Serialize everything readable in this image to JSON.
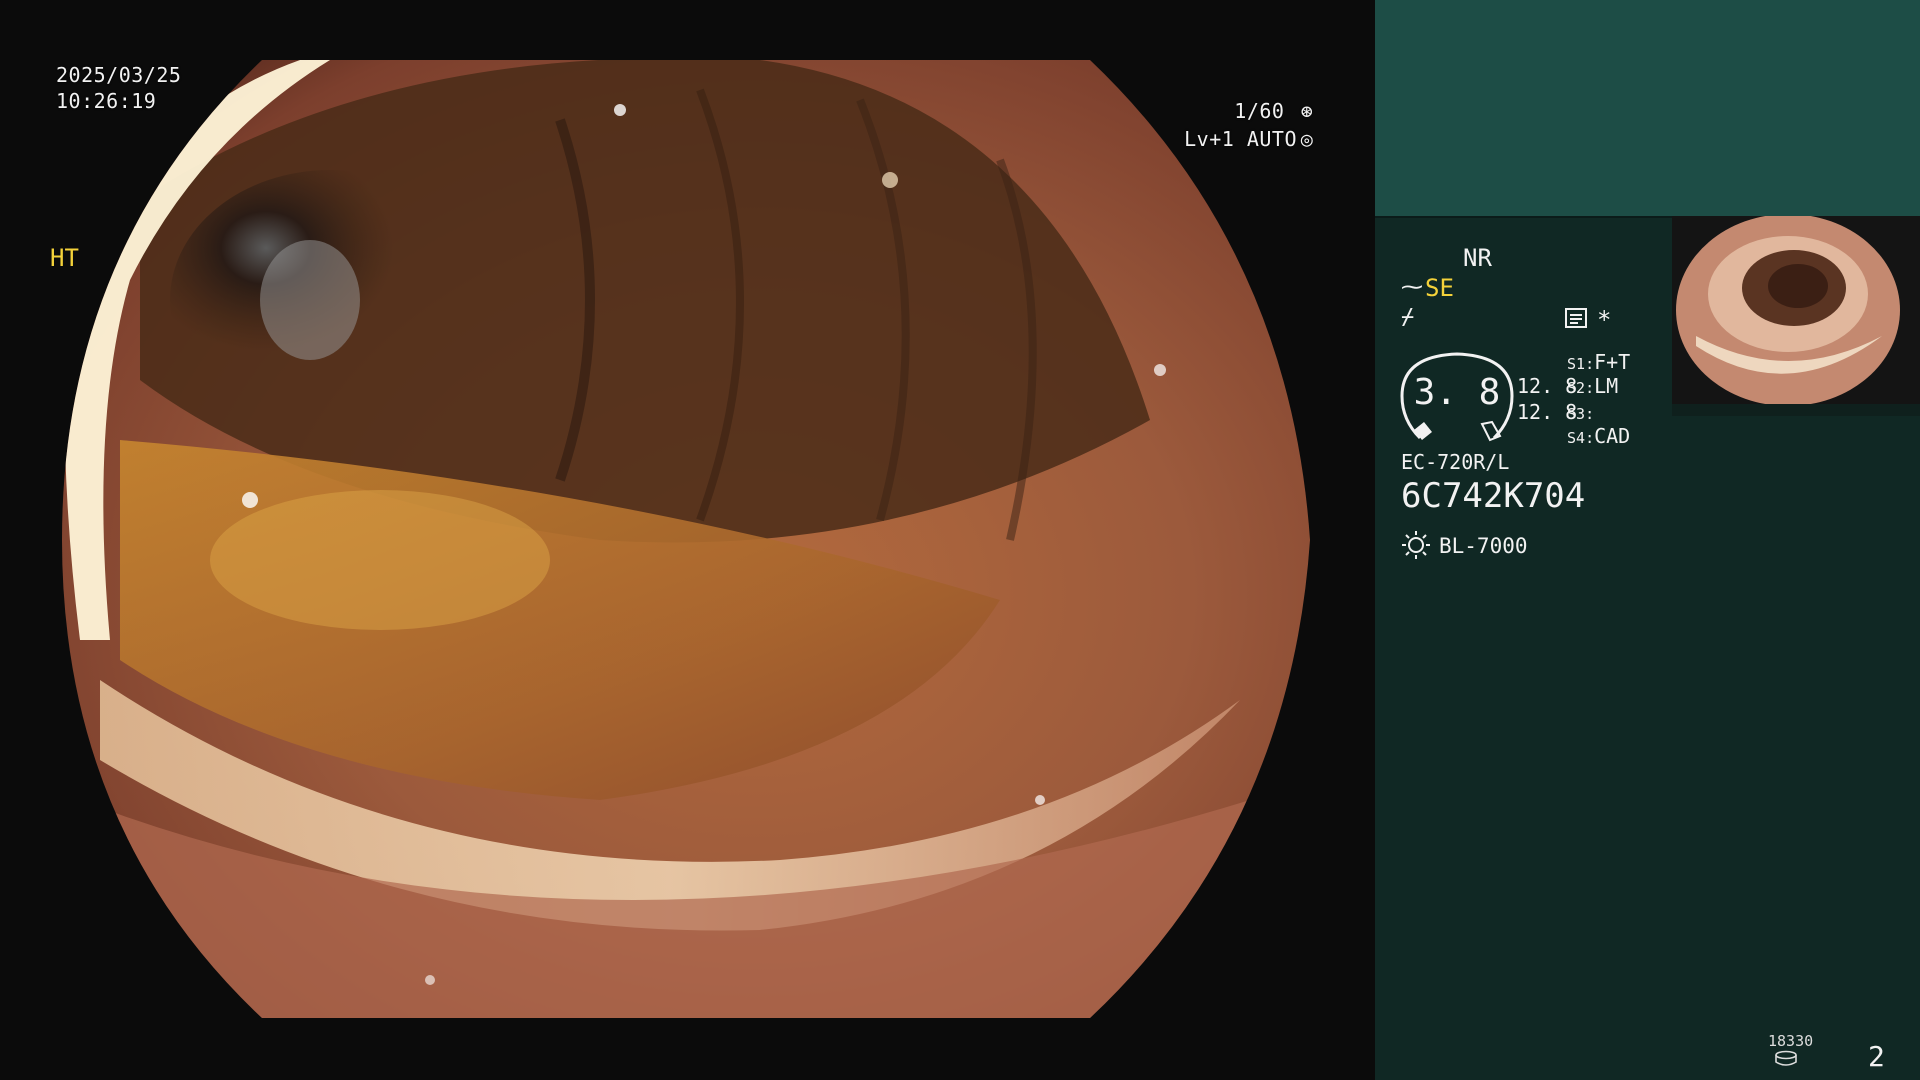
{
  "colors": {
    "panel_background": "#102824",
    "panel_header": "#1d4d46",
    "highlight_yellow": "#f4d23a",
    "text": "#f2f2f2"
  },
  "video": {
    "date": "2025/03/25",
    "time": "10:26:19",
    "shutter": "1/60",
    "shutter_icon": "aperture-icon",
    "level": "Lv+1",
    "exposure_mode": "AUTO",
    "exposure_icon": "iris-icon"
  },
  "panel": {
    "mode_ht": "HT",
    "mode_nr": "NR",
    "mode_se": "SE",
    "color_enhance_icon": "tilde-icon",
    "sharpness_icon": "sharpness-icon",
    "menu_icon": "menu-icon",
    "asterisk": "*",
    "gauge_value": "3. 8",
    "gauge_v1": "12. 8",
    "gauge_v2": "12. 8",
    "switches": [
      {
        "key": "S1",
        "sep": ":",
        "value": "F+T"
      },
      {
        "key": "S2",
        "sep": ":",
        "value": "LM"
      },
      {
        "key": "S3",
        "sep": ":",
        "value": ""
      },
      {
        "key": "S4",
        "sep": ":",
        "value": "CAD"
      }
    ],
    "scope_model": "EC-720R/L",
    "scope_serial": "6C742K704",
    "light_icon": "light-source-icon",
    "light_source": "BL-7000",
    "counter_value": "18330",
    "counter_icon": "storage-icon",
    "page_index": "2"
  }
}
